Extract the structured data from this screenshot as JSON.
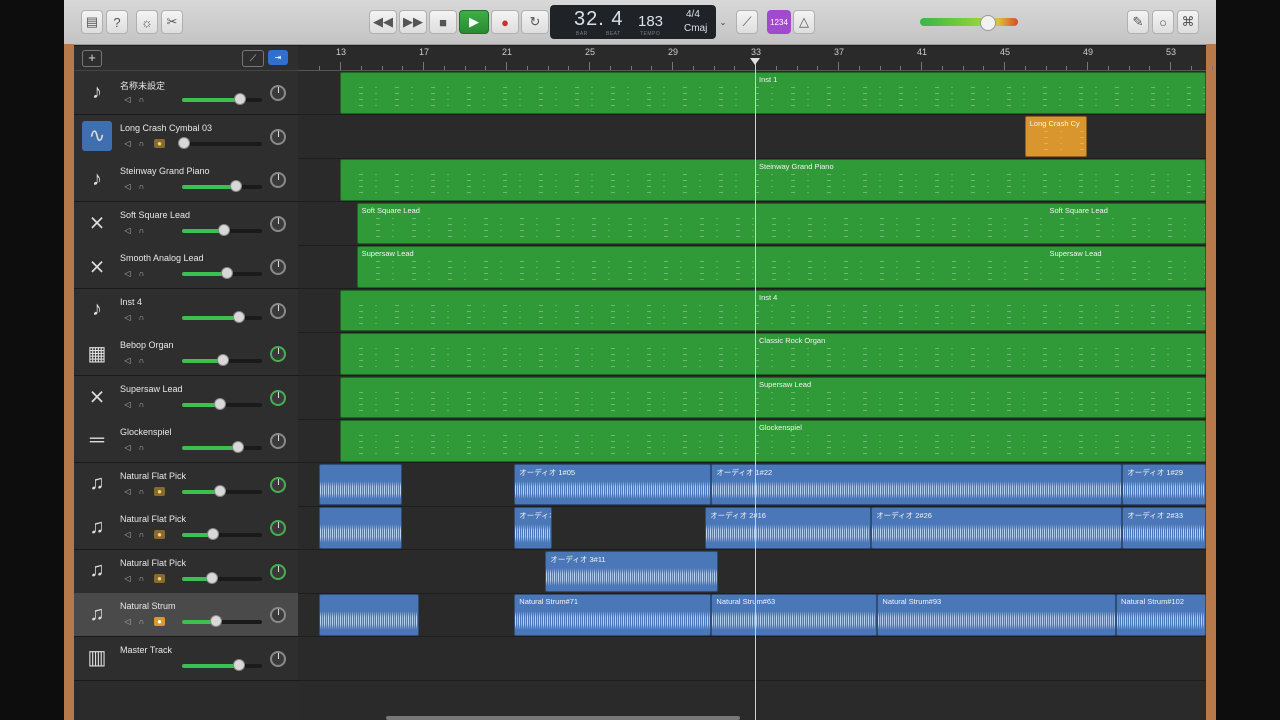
{
  "toolbar": {
    "library_icon": "library-icon",
    "help_icon": "help-icon",
    "smart_controls_icon": "smart-controls-icon",
    "editors_icon": "scissors-icon",
    "rewind": "◀◀",
    "forward": "▶▶",
    "stop": "■",
    "play": "▶",
    "record": "●",
    "cycle": "↻",
    "lcd": {
      "position": "32. 4",
      "bar_label": "BAR",
      "beat_label": "BEAT",
      "tempo": "183",
      "tempo_label": "TEMPO",
      "time_signature": "4/4",
      "key": "Cmaj"
    },
    "tuner_icon": "tuner-icon",
    "count_in": "1234",
    "metronome_icon": "metronome-icon",
    "notepad_icon": "notepad-icon",
    "browser_icon": "search-icon",
    "loops_icon": "loops-icon",
    "master_volume": 0.68
  },
  "header": {
    "add_button": "+"
  },
  "ruler": {
    "bars": [
      "13",
      "17",
      "21",
      "25",
      "29",
      "33",
      "37",
      "41",
      "45",
      "49",
      "53"
    ]
  },
  "tracks": [
    {
      "name": "名称未設定",
      "icon": "piano-icon",
      "volume": 0.72,
      "pan_green": false,
      "has_rec": false
    },
    {
      "name": "Long Crash Cymbal 03",
      "icon": "audio-waveform-icon",
      "volume": 0.02,
      "pan_green": false,
      "has_rec": true
    },
    {
      "name": "Steinway Grand Piano",
      "icon": "piano-icon",
      "volume": 0.68,
      "pan_green": false,
      "has_rec": false
    },
    {
      "name": "Soft Square Lead",
      "icon": "keyboard-stand-icon",
      "volume": 0.52,
      "pan_green": false,
      "has_rec": false
    },
    {
      "name": "Smooth Analog Lead",
      "icon": "keyboard-stand-icon",
      "volume": 0.56,
      "pan_green": false,
      "has_rec": false
    },
    {
      "name": "Inst 4",
      "icon": "piano-icon",
      "volume": 0.71,
      "pan_green": false,
      "has_rec": false
    },
    {
      "name": "Bebop Organ",
      "icon": "organ-icon",
      "volume": 0.51,
      "pan_green": true,
      "has_rec": false
    },
    {
      "name": "Supersaw Lead",
      "icon": "keyboard-stand-icon",
      "volume": 0.48,
      "pan_green": true,
      "has_rec": false
    },
    {
      "name": "Glockenspiel",
      "icon": "glockenspiel-icon",
      "volume": 0.7,
      "pan_green": false,
      "has_rec": false
    },
    {
      "name": "Natural Flat Pick",
      "icon": "guitar-icon",
      "volume": 0.47,
      "pan_green": true,
      "has_rec": true
    },
    {
      "name": "Natural Flat Pick",
      "icon": "guitar-icon",
      "volume": 0.39,
      "pan_green": true,
      "has_rec": true
    },
    {
      "name": "Natural Flat Pick",
      "icon": "guitar-icon",
      "volume": 0.37,
      "pan_green": true,
      "has_rec": true
    },
    {
      "name": "Natural Strum",
      "icon": "guitar-icon",
      "volume": 0.43,
      "pan_green": false,
      "has_rec": true,
      "selected": true
    },
    {
      "name": "Master Track",
      "icon": "master-icon",
      "volume": 0.71,
      "pan_green": false,
      "has_rec": false
    }
  ],
  "regions": [
    {
      "track": 0,
      "type": "midi",
      "label": "Inst 1",
      "start": 13,
      "end": 55,
      "label_at": 33
    },
    {
      "track": 1,
      "type": "drum",
      "label": "Long Crash Cy",
      "start": 46,
      "end": 49
    },
    {
      "track": 2,
      "type": "midi",
      "label": "Steinway Grand Piano",
      "start": 13,
      "end": 55,
      "label_at": 33
    },
    {
      "track": 3,
      "type": "midi",
      "label": "Soft Square Lead",
      "start": 13.8,
      "end": 55,
      "label2": "Soft Square Lead",
      "label2_at": 47
    },
    {
      "track": 4,
      "type": "midi",
      "label": "Supersaw Lead",
      "start": 13.8,
      "end": 55,
      "label2": "Supersaw Lead",
      "label2_at": 47
    },
    {
      "track": 5,
      "type": "midi",
      "label": "Inst 4",
      "start": 13,
      "end": 55,
      "label_at": 33
    },
    {
      "track": 6,
      "type": "midi",
      "label": "Classic Rock Organ",
      "start": 13,
      "end": 55,
      "label_at": 33
    },
    {
      "track": 7,
      "type": "midi",
      "label": "Supersaw Lead",
      "start": 13,
      "end": 55,
      "label_at": 33
    },
    {
      "track": 8,
      "type": "midi",
      "label": "Glockenspiel",
      "start": 13,
      "end": 55,
      "label_at": 33
    },
    {
      "track": 9,
      "type": "audio",
      "label": "",
      "start": 12,
      "end": 16
    },
    {
      "track": 9,
      "type": "audio",
      "label": "オーディオ 1#05",
      "start": 21.4,
      "end": 30.9
    },
    {
      "track": 9,
      "type": "audio",
      "label": "オーディオ 1#22",
      "start": 30.9,
      "end": 50.7
    },
    {
      "track": 9,
      "type": "audio",
      "label": "オーディオ 1#29",
      "start": 50.7,
      "end": 56
    },
    {
      "track": 10,
      "type": "audio",
      "label": "",
      "start": 12,
      "end": 16
    },
    {
      "track": 10,
      "type": "audio",
      "label": "オーディオ",
      "start": 21.4,
      "end": 23.2
    },
    {
      "track": 10,
      "type": "audio",
      "label": "オーディオ 2#16",
      "start": 30.6,
      "end": 38.6
    },
    {
      "track": 10,
      "type": "audio",
      "label": "オーディオ 2#26",
      "start": 38.6,
      "end": 50.7
    },
    {
      "track": 10,
      "type": "audio",
      "label": "オーディオ 2#33",
      "start": 50.7,
      "end": 56
    },
    {
      "track": 11,
      "type": "audio",
      "label": "オーディオ 3#11",
      "start": 22.9,
      "end": 31.2
    },
    {
      "track": 12,
      "type": "audio",
      "label": "",
      "start": 12,
      "end": 16.8
    },
    {
      "track": 12,
      "type": "audio",
      "label": "Natural Strum#71",
      "start": 21.4,
      "end": 30.9
    },
    {
      "track": 12,
      "type": "audio",
      "label": "Natural Strum#63",
      "start": 30.9,
      "end": 38.9
    },
    {
      "track": 12,
      "type": "audio",
      "label": "Natural Strum#93",
      "start": 38.9,
      "end": 50.4
    },
    {
      "track": 12,
      "type": "audio",
      "label": "Natural Strum#102",
      "start": 50.4,
      "end": 56
    }
  ],
  "playhead_bar": 33
}
